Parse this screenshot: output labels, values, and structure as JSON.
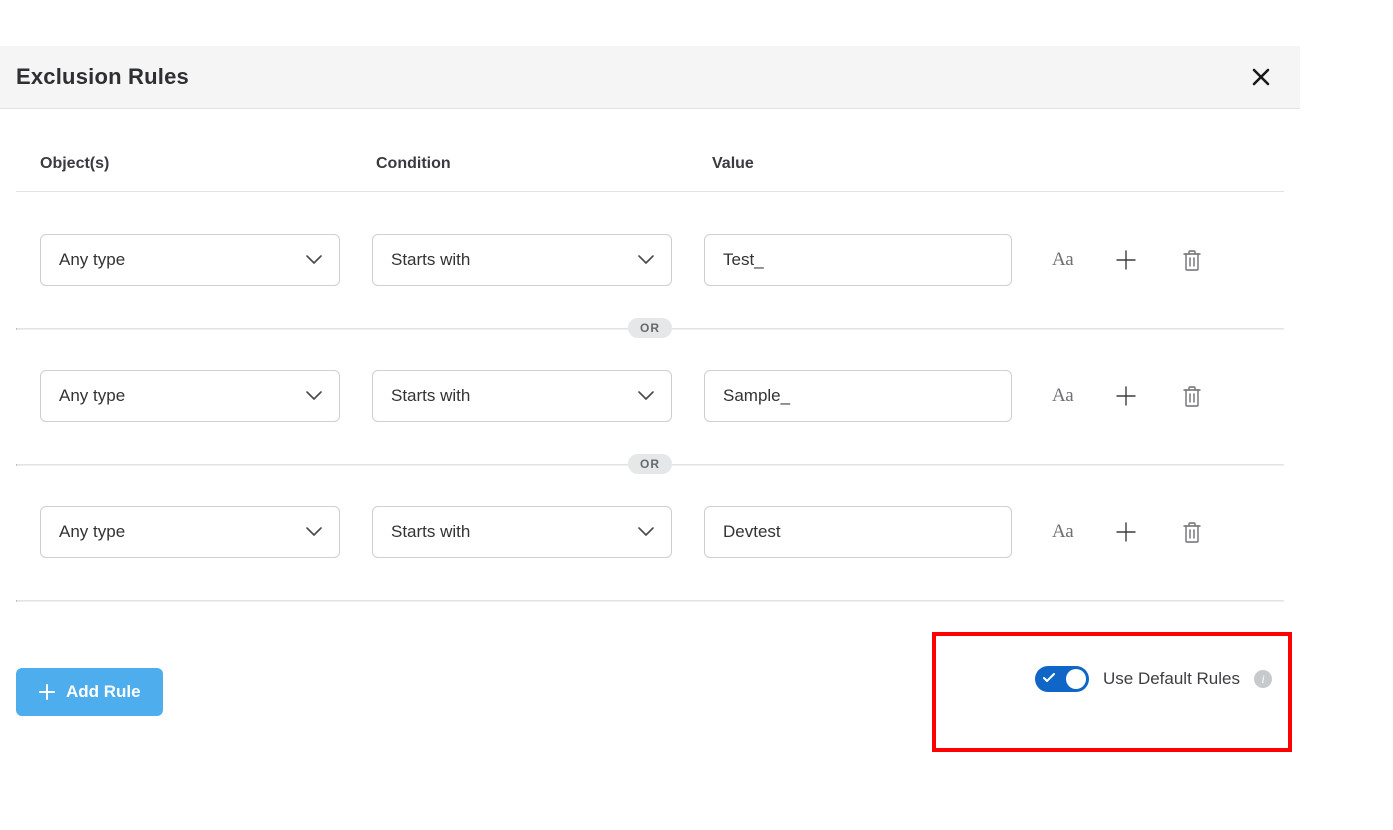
{
  "header": {
    "title": "Exclusion Rules"
  },
  "columns": {
    "objects": "Object(s)",
    "condition": "Condition",
    "value": "Value"
  },
  "separator_label": "OR",
  "rules": [
    {
      "object": "Any type",
      "condition": "Starts with",
      "value": "Test_"
    },
    {
      "object": "Any type",
      "condition": "Starts with",
      "value": "Sample_"
    },
    {
      "object": "Any type",
      "condition": "Starts with",
      "value": "Devtest"
    }
  ],
  "row_actions": {
    "case_label": "Aa"
  },
  "footer": {
    "add_rule_label": "Add Rule",
    "use_default_rules_label": "Use Default Rules",
    "default_rules_on": true,
    "info_glyph": "i"
  }
}
